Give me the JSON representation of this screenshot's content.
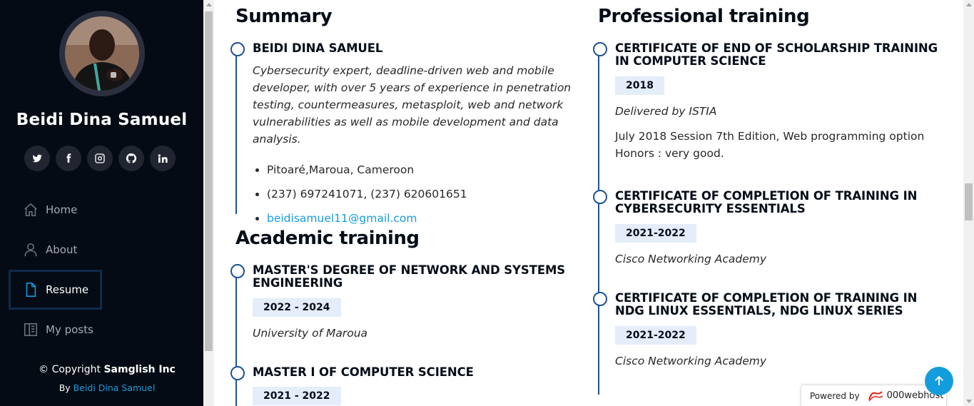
{
  "profile": {
    "name": "Beidi Dina Samuel",
    "avatar_icon": "profile-photo"
  },
  "socials": [
    {
      "name": "twitter-icon"
    },
    {
      "name": "facebook-icon"
    },
    {
      "name": "instagram-icon"
    },
    {
      "name": "github-icon"
    },
    {
      "name": "linkedin-icon"
    }
  ],
  "nav": {
    "home": "Home",
    "about": "About",
    "resume": "Resume",
    "posts": "My posts",
    "active": "Resume"
  },
  "footer": {
    "copyright_prefix": "© Copyright",
    "copyright_company": "Samglish Inc",
    "credits_prefix": "By",
    "credits_name": "Beidi Dina Samuel"
  },
  "summary": {
    "title": "Summary",
    "name": "BEIDI DINA SAMUEL",
    "description": "Cybersecurity expert, deadline-driven web and mobile developer, with over 5 years of experience in penetration testing, countermeasures, metasploit, web and network vulnerabilities as well as mobile development and data analysis.",
    "address": "Pitoaré,Maroua, Cameroon",
    "phone": "(237) 697241071, (237) 620601651",
    "email": "beidisamuel11@gmail.com"
  },
  "academic": {
    "title": "Academic training",
    "items": [
      {
        "title": "MASTER'S DEGREE OF NETWORK AND SYSTEMS ENGINEERING",
        "date": "2022 - 2024",
        "place": "University of Maroua"
      },
      {
        "title": "MASTER I OF COMPUTER SCIENCE",
        "date": "2021 - 2022"
      }
    ]
  },
  "professional": {
    "title": "Professional training",
    "items": [
      {
        "title": "CERTIFICATE OF END OF SCHOLARSHIP TRAINING IN COMPUTER SCIENCE",
        "date": "2018",
        "place": "Delivered by ISTIA",
        "description": "July 2018 Session 7th Edition, Web programming option Honors : very good."
      },
      {
        "title": "CERTIFICATE OF COMPLETION OF TRAINING IN CYBERSECURITY ESSENTIALS",
        "date": "2021-2022",
        "place": "Cisco Networking Academy"
      },
      {
        "title": "CERTIFICATE OF COMPLETION OF TRAINING IN NDG LINUX ESSENTIALS, NDG LINUX SERIES",
        "date": "2021-2022",
        "place": "Cisco Networking Academy"
      }
    ]
  },
  "host_badge": {
    "prefix": "Powered by",
    "brand": "000webhost"
  },
  "colors": {
    "sidebar_bg": "#040b14",
    "accent": "#149ddd",
    "timeline": "#1f5297",
    "date_bg": "#e4edf9"
  }
}
